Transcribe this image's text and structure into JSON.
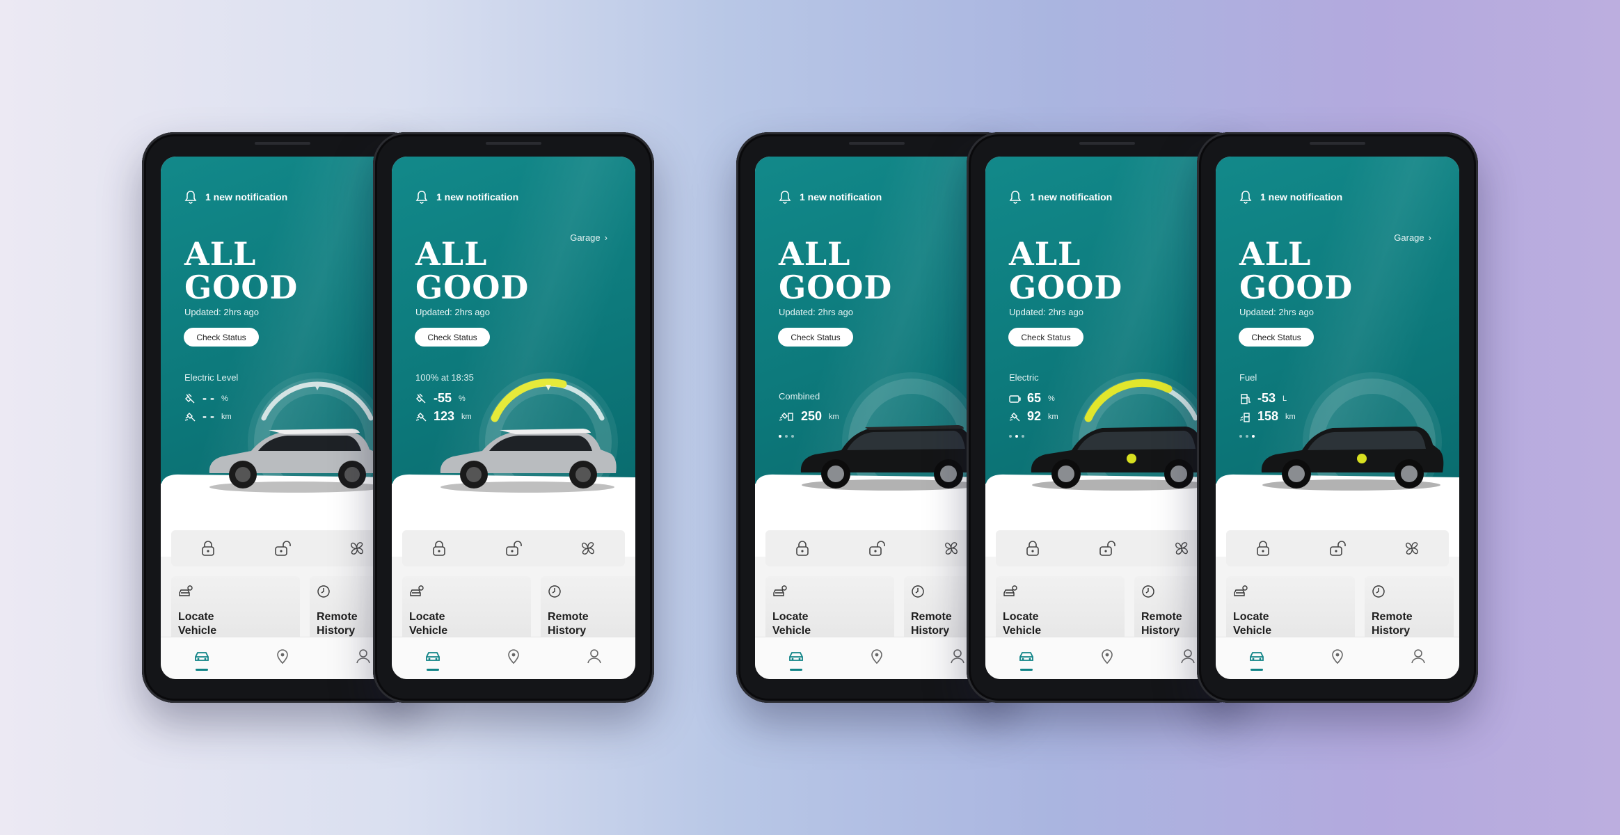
{
  "colors": {
    "teal": "#0e7f81",
    "gauge_yellow": "#e6ea3a",
    "gauge_track": "#cfe4e4"
  },
  "common": {
    "notification": "1 new notification",
    "garage": "Garage",
    "title_line1": "ALL",
    "title_line2": "GOOD",
    "updated": "Updated: 2hrs ago",
    "check_status": "Check Status",
    "locate_vehicle": "Locate\nVehicle",
    "remote_history": "Remote\nHistory"
  },
  "phones": [
    {
      "level_label": "Electric Level",
      "stat1_value": "- -",
      "stat1_unit": "%",
      "stat2_value": "- -",
      "stat2_unit": "km",
      "gauge_charge": 0.0,
      "car": "silver-mini-hatch"
    },
    {
      "level_label": "100% at 18:35",
      "stat1_value": "55",
      "stat1_unit": "%",
      "stat2_value": "123",
      "stat2_unit": "km",
      "gauge_charge": 0.55,
      "car": "silver-mini-hatch"
    },
    {
      "level_label": "Combined",
      "stat1_value": "250",
      "stat1_unit": "km",
      "carousel_index": 0,
      "car": "black-mini-countryman"
    },
    {
      "level_label": "Electric",
      "stat1_value": "65",
      "stat1_unit": "%",
      "stat2_value": "92",
      "stat2_unit": "km",
      "gauge_charge": 0.65,
      "carousel_index": 1,
      "car": "black-mini-countryman"
    },
    {
      "level_label": "Fuel",
      "stat1_value": "53",
      "stat1_unit": "L",
      "stat2_value": "158",
      "stat2_unit": "km",
      "gauge_charge": null,
      "carousel_index": 2,
      "car": "black-mini-countryman"
    }
  ],
  "icons": {
    "notification": "bell-icon",
    "actions": [
      "lock-icon",
      "unlock-icon",
      "fan-icon"
    ],
    "nav": [
      "car-icon",
      "map-pin-icon",
      "profile-icon"
    ]
  }
}
